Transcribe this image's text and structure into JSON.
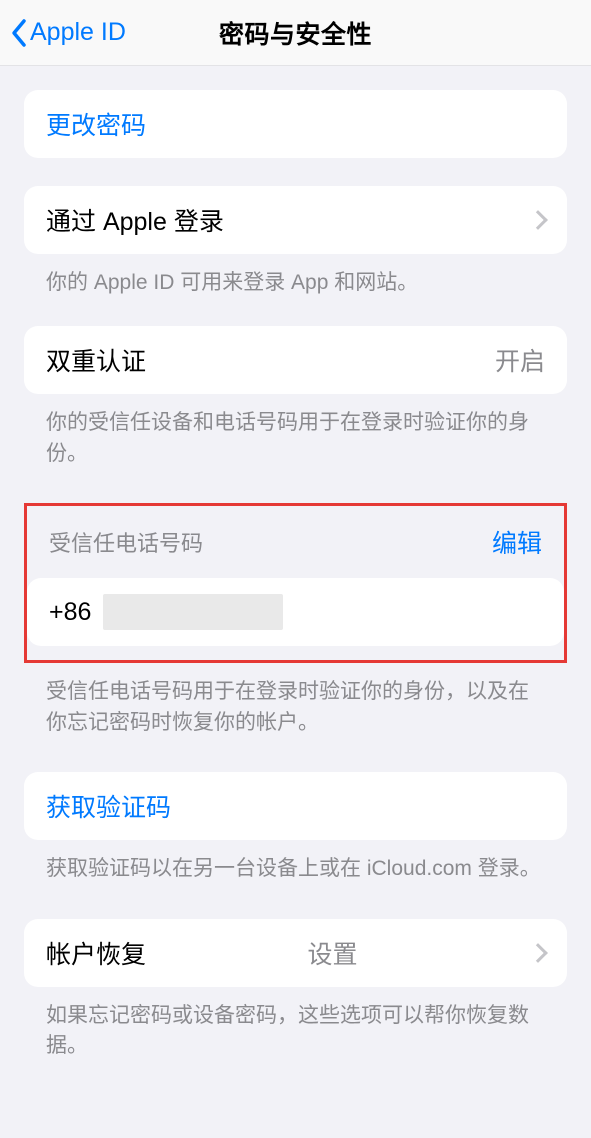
{
  "nav": {
    "back_label": "Apple ID",
    "title": "密码与安全性"
  },
  "groups": {
    "change_password": {
      "label": "更改密码"
    },
    "sign_in_with_apple": {
      "label": "通过 Apple 登录",
      "note": "你的 Apple ID 可用来登录 App 和网站。"
    },
    "two_factor": {
      "label": "双重认证",
      "value": "开启",
      "note": "你的受信任设备和电话号码用于在登录时验证你的身份。"
    },
    "trusted_phone": {
      "header": "受信任电话号码",
      "edit_label": "编辑",
      "prefix": "+86",
      "note": "受信任电话号码用于在登录时验证你的身份，以及在你忘记密码时恢复你的帐户。"
    },
    "get_code": {
      "label": "获取验证码",
      "note": "获取验证码以在另一台设备上或在 iCloud.com 登录。"
    },
    "account_recovery": {
      "label": "帐户恢复",
      "value": "设置",
      "note": "如果忘记密码或设备密码，这些选项可以帮你恢复数据。"
    }
  }
}
